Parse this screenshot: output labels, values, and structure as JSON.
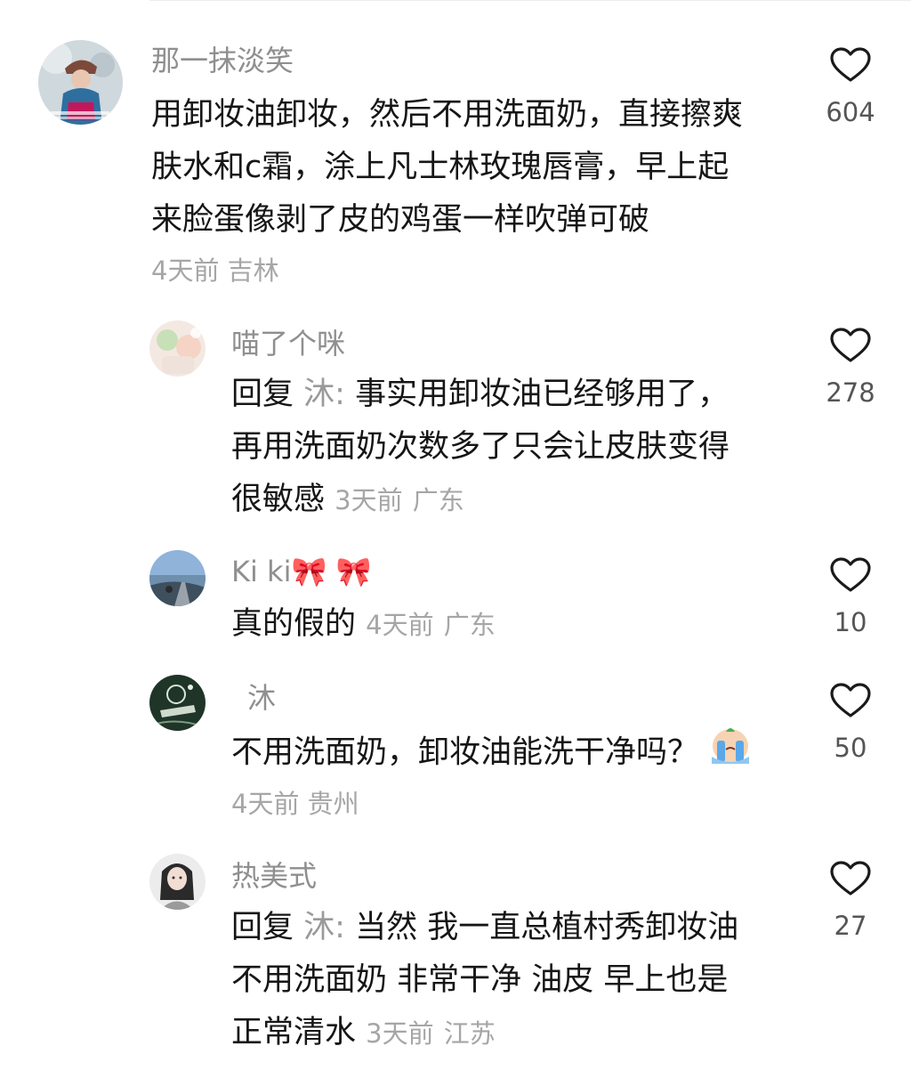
{
  "comments": [
    {
      "username": "那一抹淡笑",
      "text_lines": [
        "用卸妆油卸妆，然后不用洗面奶，直接擦爽",
        "肤水和c霜，涂上凡士林玫瑰唇膏，早上起",
        "来脸蛋像剥了皮的鸡蛋一样吹弹可破"
      ],
      "time": "4天前",
      "location": "吉林",
      "likes": "604",
      "avatar_icon": "avatar-girl-cap-icon"
    },
    {
      "username": "喵了个咪",
      "reply_prefix": "回复",
      "reply_to": "沐:",
      "text_lines": [
        "事实用卸妆油已经够用了，",
        "再用洗面奶次数多了只会让皮肤变得",
        "很敏感"
      ],
      "time": "3天前",
      "location": "广东",
      "likes": "278",
      "avatar_icon": "avatar-pastel-icon"
    },
    {
      "username": "Ki ki",
      "username_emoji": "🎀 🎀",
      "text_lines": [
        "真的假的"
      ],
      "time": "4天前",
      "location": "广东",
      "likes": "10",
      "avatar_icon": "avatar-road-icon"
    },
    {
      "username": "沐",
      "text_lines": [
        "不用洗面奶，卸妆油能洗干净吗？"
      ],
      "text_emoji": "crying-face-emoji",
      "time": "4天前",
      "location": "贵州",
      "likes": "50",
      "avatar_icon": "avatar-dark-green-icon"
    },
    {
      "username": "热美式",
      "reply_prefix": "回复",
      "reply_to": "沐:",
      "text_lines": [
        "当然 我一直总植村秀卸妆油",
        "不用洗面奶 非常干净 油皮 早上也是",
        "正常清水"
      ],
      "time": "3天前",
      "location": "江苏",
      "likes": "27",
      "avatar_icon": "avatar-portrait-icon"
    }
  ],
  "icons": {
    "like": "heart-outline-icon"
  },
  "colors": {
    "text_primary": "#161616",
    "text_secondary": "#8f8f8f",
    "meta": "#a6a6a6"
  }
}
